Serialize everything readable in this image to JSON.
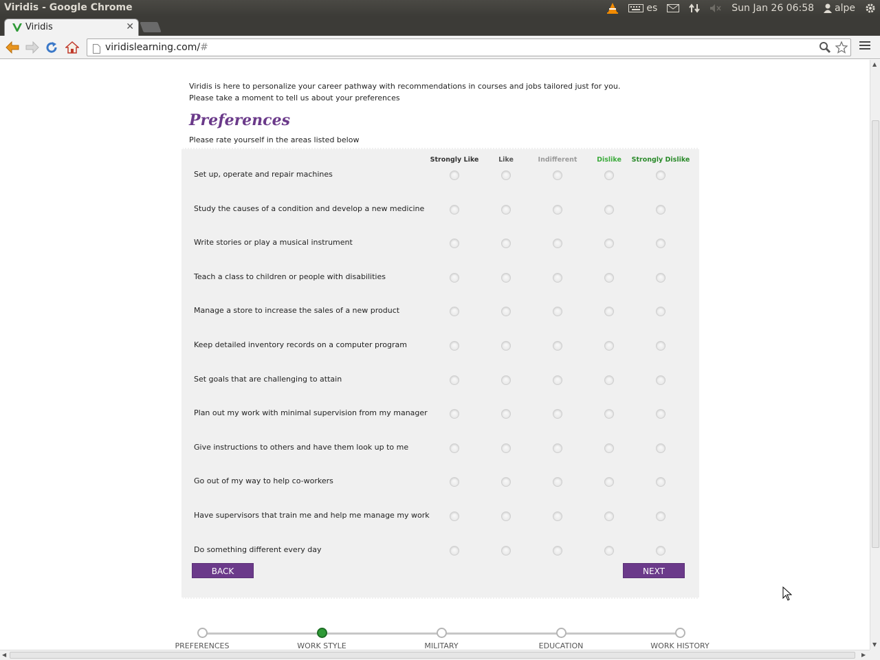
{
  "window": {
    "title": "Viridis - Google Chrome"
  },
  "tray": {
    "keyboard": "es",
    "clock": "Sun Jan 26 06:58",
    "user": "alpe"
  },
  "tab": {
    "title": "Viridis"
  },
  "omnibox": {
    "host": "viridislearning.com/",
    "hash": "#"
  },
  "page": {
    "intro_line1": "Viridis is here to personalize your career pathway with recommendations in courses and jobs tailored just for you.",
    "intro_line2": "Please take a moment to tell us about your preferences",
    "title": "Preferences",
    "instruction": "Please rate yourself in the areas listed below",
    "columns": [
      {
        "label": "Strongly Like",
        "color": "#333333"
      },
      {
        "label": "Like",
        "color": "#555555"
      },
      {
        "label": "Indifferent",
        "color": "#9a9a9a"
      },
      {
        "label": "Dislike",
        "color": "#3cab3c"
      },
      {
        "label": "Strongly Dislike",
        "color": "#2a8a2a"
      }
    ],
    "rows": [
      "Set up, operate and repair machines",
      "Study the causes of a condition and develop a new medicine",
      "Write stories or play a musical instrument",
      "Teach a class to children or people with disabilities",
      "Manage a store to increase the sales of a new product",
      "Keep detailed inventory records on a computer program",
      "Set goals that are challenging to attain",
      "Plan out my work with minimal supervision from my manager",
      "Give instructions to others and have them look up to me",
      "Go out of my way to help co-workers",
      "Have supervisors that train me and help me manage my work",
      "Do something different every day"
    ],
    "back_label": "BACK",
    "next_label": "NEXT"
  },
  "progress": {
    "steps": [
      "PREFERENCES",
      "WORK STYLE",
      "MILITARY",
      "EDUCATION",
      "WORK HISTORY"
    ],
    "active_index": 1
  }
}
